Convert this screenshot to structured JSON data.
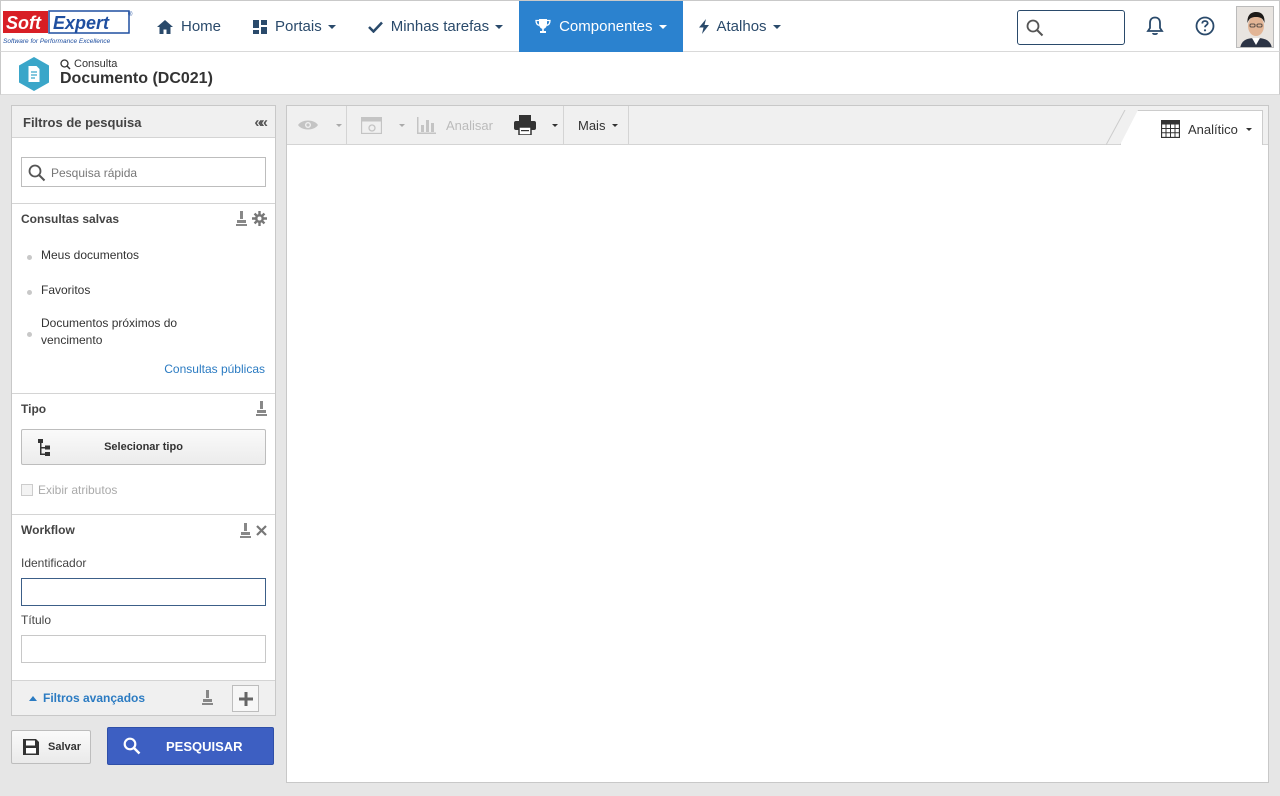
{
  "app": {
    "logo_text": "Soft Expert",
    "logo_tagline": "Software for Performance Excellence"
  },
  "nav": {
    "items": [
      {
        "label": "Home",
        "icon": "home-icon",
        "dropdown": false
      },
      {
        "label": "Portais",
        "icon": "grid-icon",
        "dropdown": true
      },
      {
        "label": "Minhas tarefas",
        "icon": "check-icon",
        "dropdown": true
      },
      {
        "label": "Componentes",
        "icon": "trophy-icon",
        "dropdown": true,
        "active": true
      },
      {
        "label": "Atalhos",
        "icon": "bolt-icon",
        "dropdown": true
      }
    ],
    "search_placeholder": ""
  },
  "page": {
    "subtitle": "Consulta",
    "title": "Documento (DC021)"
  },
  "filters": {
    "title": "Filtros de pesquisa",
    "quick_search_placeholder": "Pesquisa rápida",
    "saved": {
      "title": "Consultas salvas",
      "items": [
        "Meus documentos",
        "Favoritos",
        "Documentos próximos do vencimento"
      ],
      "public_link": "Consultas públicas"
    },
    "tipo": {
      "title": "Tipo",
      "select_label": "Selecionar tipo",
      "show_attributes": "Exibir atributos"
    },
    "workflow": {
      "title": "Workflow",
      "identifier_label": "Identificador",
      "identifier_value": "",
      "title_label": "Título",
      "title_value": ""
    },
    "advanced": "Filtros avançados"
  },
  "actions": {
    "save": "Salvar",
    "search": "PESQUISAR"
  },
  "toolbar": {
    "analyze": "Analisar",
    "more": "Mais",
    "view_mode": "Analítico"
  },
  "colors": {
    "accent": "#2b82cf",
    "primary_button": "#3d5fc2",
    "link": "#2b7bc2"
  }
}
